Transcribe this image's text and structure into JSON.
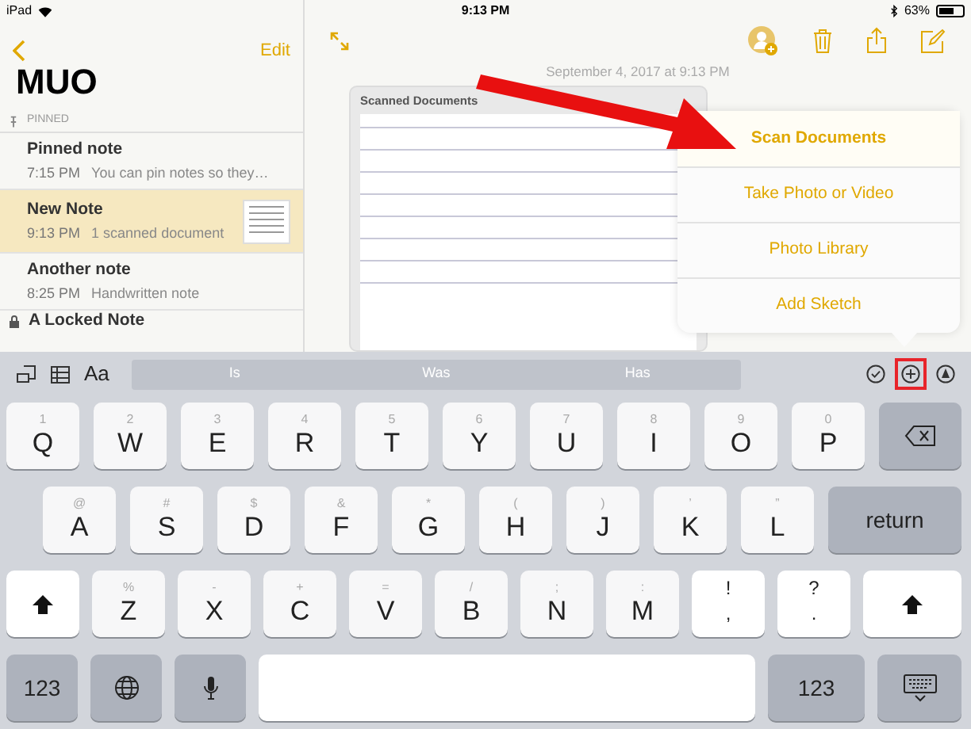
{
  "status_bar": {
    "device": "iPad",
    "time": "9:13 PM",
    "battery": "63%"
  },
  "sidebar": {
    "edit": "Edit",
    "title": "MUO",
    "section": "PINNED",
    "notes": [
      {
        "title": "Pinned note",
        "time": "7:15 PM",
        "preview": "You can pin notes so they…",
        "selected": false,
        "kind": "text"
      },
      {
        "title": "New Note",
        "time": "9:13 PM",
        "preview": "1 scanned document",
        "selected": true,
        "kind": "scan"
      },
      {
        "title": "Another note",
        "time": "8:25 PM",
        "preview": "Handwritten note",
        "selected": false,
        "kind": "text"
      },
      {
        "title": "A Locked Note",
        "selected": false,
        "kind": "locked"
      }
    ]
  },
  "note": {
    "date": "September 4, 2017 at 9:13 PM",
    "attachment_title": "Scanned Documents"
  },
  "popover": {
    "items": [
      {
        "label": "Scan Documents",
        "highlighted": true
      },
      {
        "label": "Take Photo or Video",
        "highlighted": false
      },
      {
        "label": "Photo Library",
        "highlighted": false
      },
      {
        "label": "Add Sketch",
        "highlighted": false
      }
    ]
  },
  "keyboard": {
    "format_label": "Aa",
    "suggestions": [
      "Is",
      "Was",
      "Has"
    ],
    "letter_row_1": [
      {
        "kind": "letter",
        "label": "Q",
        "hint": "1"
      },
      {
        "kind": "letter",
        "label": "W",
        "hint": "2"
      },
      {
        "kind": "letter",
        "label": "E",
        "hint": "3"
      },
      {
        "kind": "letter",
        "label": "R",
        "hint": "4"
      },
      {
        "kind": "letter",
        "label": "T",
        "hint": "5"
      },
      {
        "kind": "letter",
        "label": "Y",
        "hint": "6"
      },
      {
        "kind": "letter",
        "label": "U",
        "hint": "7"
      },
      {
        "kind": "letter",
        "label": "I",
        "hint": "8"
      },
      {
        "kind": "letter",
        "label": "O",
        "hint": "9"
      },
      {
        "kind": "letter",
        "label": "P",
        "hint": "0"
      },
      {
        "kind": "delete"
      }
    ],
    "letter_row_2": [
      {
        "kind": "letter",
        "label": "A",
        "hint": "@"
      },
      {
        "kind": "letter",
        "label": "S",
        "hint": "#"
      },
      {
        "kind": "letter",
        "label": "D",
        "hint": "$"
      },
      {
        "kind": "letter",
        "label": "F",
        "hint": "&"
      },
      {
        "kind": "letter",
        "label": "G",
        "hint": "*"
      },
      {
        "kind": "letter",
        "label": "H",
        "hint": "("
      },
      {
        "kind": "letter",
        "label": "J",
        "hint": ")"
      },
      {
        "kind": "letter",
        "label": "K",
        "hint": "’"
      },
      {
        "kind": "letter",
        "label": "L",
        "hint": "”"
      },
      {
        "kind": "return",
        "label": "return"
      }
    ],
    "letter_row_3": [
      {
        "kind": "shift"
      },
      {
        "kind": "letter",
        "label": "Z",
        "hint": "%"
      },
      {
        "kind": "letter",
        "label": "X",
        "hint": "-"
      },
      {
        "kind": "letter",
        "label": "C",
        "hint": "+"
      },
      {
        "kind": "letter",
        "label": "V",
        "hint": "="
      },
      {
        "kind": "letter",
        "label": "B",
        "hint": "/"
      },
      {
        "kind": "letter",
        "label": "N",
        "hint": ";"
      },
      {
        "kind": "letter",
        "label": "M",
        "hint": ":"
      },
      {
        "kind": "punct",
        "label": ",",
        "hint": "!"
      },
      {
        "kind": "punct",
        "label": ".",
        "hint": "?"
      },
      {
        "kind": "shift"
      }
    ],
    "function_row": [
      {
        "kind": "numbers",
        "label": "123"
      },
      {
        "kind": "globe"
      },
      {
        "kind": "mic"
      },
      {
        "kind": "space"
      },
      {
        "kind": "numbers",
        "label": "123"
      },
      {
        "kind": "dismiss"
      }
    ]
  }
}
